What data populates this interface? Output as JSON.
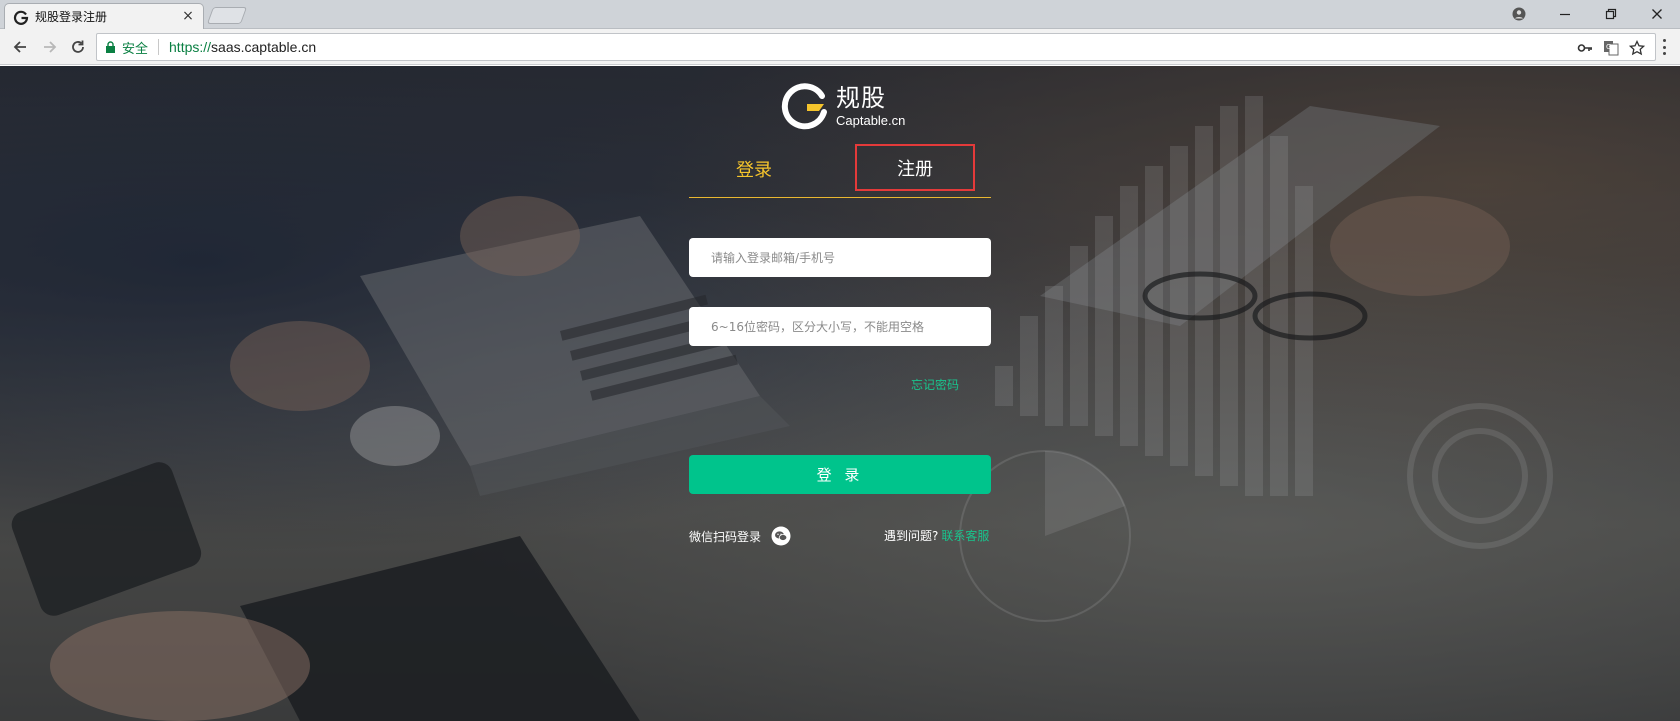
{
  "browser": {
    "tab_title": "规股登录注册",
    "security_label": "安全",
    "url_scheme": "https://",
    "url_host": "saas.captable.cn"
  },
  "brand": {
    "name_cn": "规股",
    "name_en": "Captable.cn"
  },
  "auth_tabs": {
    "login": "登录",
    "register": "注册"
  },
  "form": {
    "account_placeholder": "请输入登录邮箱/手机号",
    "password_placeholder": "6~16位密码，区分大小写，不能用空格",
    "forgot_password": "忘记密码",
    "submit_label": "登 录"
  },
  "footer": {
    "wechat_login": "微信扫码登录",
    "help_prompt": "遇到问题?",
    "contact_support": "联系客服"
  },
  "colors": {
    "accent_green": "#00c48c",
    "tab_yellow": "#f5c42c",
    "highlight_red": "#e43a3a"
  }
}
